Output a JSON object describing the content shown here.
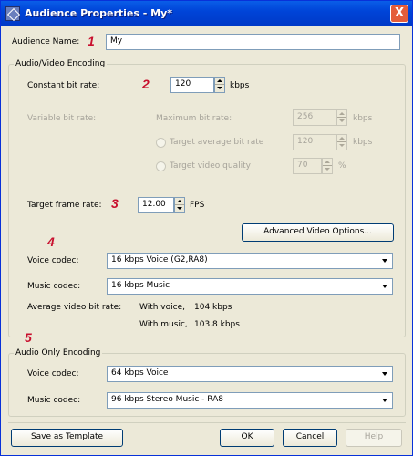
{
  "window": {
    "title": "Audience Properties - My*",
    "close": "X"
  },
  "audience_name": {
    "label": "Audience Name:",
    "value": "My"
  },
  "steps": [
    "1",
    "2",
    "3",
    "4",
    "5"
  ],
  "av_group": {
    "title": "Audio/Video Encoding",
    "constant_label": "Constant bit rate:",
    "constant_value": "120",
    "constant_unit": "kbps",
    "variable_label": "Variable bit rate:",
    "max_label": "Maximum bit rate:",
    "max_value": "256",
    "max_unit": "kbps",
    "target_avg_label": "Target average bit rate",
    "target_avg_value": "120",
    "target_avg_unit": "kbps",
    "target_quality_label": "Target video quality",
    "target_quality_value": "70",
    "target_quality_unit": "%",
    "frame_label": "Target frame rate:",
    "frame_value": "12.00",
    "frame_unit": "FPS",
    "advanced_button": "Advanced Video Options...",
    "voice_label": "Voice codec:",
    "voice_value": "16 kbps Voice (G2,RA8)",
    "music_label": "Music codec:",
    "music_value": "16 kbps Music",
    "avg_label": "Average video bit rate:",
    "with_voice_label": "With voice,",
    "with_voice_value": "104 kbps",
    "with_music_label": "With music,",
    "with_music_value": "103.8 kbps"
  },
  "audio_group": {
    "title": "Audio Only Encoding",
    "voice_label": "Voice codec:",
    "voice_value": "64 kbps Voice",
    "music_label": "Music codec:",
    "music_value": "96 kbps Stereo Music - RA8"
  },
  "footer": {
    "save_template": "Save as Template",
    "ok": "OK",
    "cancel": "Cancel",
    "help": "Help"
  }
}
